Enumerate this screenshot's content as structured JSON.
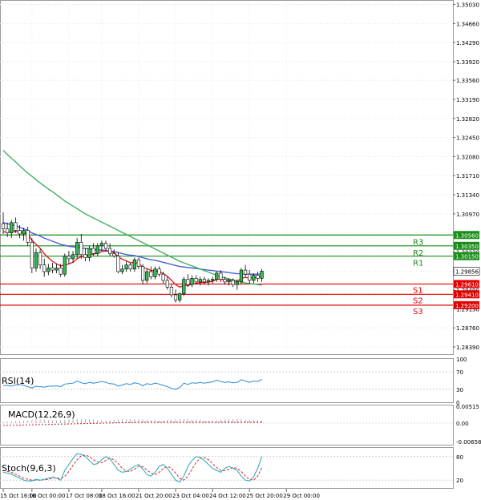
{
  "chart_data": {
    "type": "candlestick",
    "price_axis": {
      "ticks": [
        "1.35030",
        "1.34660",
        "1.34290",
        "1.33920",
        "1.33560",
        "1.33190",
        "1.32820",
        "1.32450",
        "1.32080",
        "1.31710",
        "1.31340",
        "1.30970",
        "1.30600",
        "1.30230",
        "1.29860",
        "1.29490",
        "1.29130",
        "1.28760",
        "1.28390"
      ],
      "ylim": [
        1.2825,
        1.351
      ]
    },
    "time_axis": {
      "labels": [
        "15 Oct 16:00",
        "16 Oct 00:00",
        "17 Oct 08:00",
        "18 Oct 16:00",
        "21 Oct 20:00",
        "23 Oct 04:00",
        "24 Oct 12:00",
        "25 Oct 20:00",
        "29 Oct 00:00"
      ],
      "label_bars": [
        0,
        7,
        16,
        24,
        33,
        42,
        51,
        60,
        69
      ]
    },
    "candles": [
      {
        "o": 1.3078,
        "h": 1.31,
        "l": 1.3058,
        "c": 1.3068
      },
      {
        "o": 1.3068,
        "h": 1.308,
        "l": 1.3052,
        "c": 1.306
      },
      {
        "o": 1.306,
        "h": 1.3085,
        "l": 1.305,
        "c": 1.308
      },
      {
        "o": 1.308,
        "h": 1.309,
        "l": 1.306,
        "c": 1.3065
      },
      {
        "o": 1.3065,
        "h": 1.3075,
        "l": 1.305,
        "c": 1.3058
      },
      {
        "o": 1.3058,
        "h": 1.307,
        "l": 1.3045,
        "c": 1.3065
      },
      {
        "o": 1.3065,
        "h": 1.3072,
        "l": 1.3035,
        "c": 1.3042
      },
      {
        "o": 1.3042,
        "h": 1.305,
        "l": 1.2982,
        "c": 1.2992
      },
      {
        "o": 1.2992,
        "h": 1.303,
        "l": 1.2985,
        "c": 1.3022
      },
      {
        "o": 1.3022,
        "h": 1.3028,
        "l": 1.299,
        "c": 1.2998
      },
      {
        "o": 1.2998,
        "h": 1.301,
        "l": 1.2975,
        "c": 1.2985
      },
      {
        "o": 1.2985,
        "h": 1.3,
        "l": 1.2978,
        "c": 1.2992
      },
      {
        "o": 1.2992,
        "h": 1.3002,
        "l": 1.2982,
        "c": 1.2988
      },
      {
        "o": 1.2988,
        "h": 1.3,
        "l": 1.2982,
        "c": 1.2992
      },
      {
        "o": 1.2992,
        "h": 1.3,
        "l": 1.2975,
        "c": 1.298
      },
      {
        "o": 1.298,
        "h": 1.302,
        "l": 1.2975,
        "c": 1.3015
      },
      {
        "o": 1.3015,
        "h": 1.3025,
        "l": 1.3,
        "c": 1.301
      },
      {
        "o": 1.301,
        "h": 1.3025,
        "l": 1.3002,
        "c": 1.3018
      },
      {
        "o": 1.3018,
        "h": 1.305,
        "l": 1.301,
        "c": 1.3042
      },
      {
        "o": 1.3042,
        "h": 1.3058,
        "l": 1.301,
        "c": 1.3018
      },
      {
        "o": 1.3018,
        "h": 1.303,
        "l": 1.3005,
        "c": 1.3012
      },
      {
        "o": 1.3012,
        "h": 1.3035,
        "l": 1.3005,
        "c": 1.303
      },
      {
        "o": 1.303,
        "h": 1.304,
        "l": 1.3015,
        "c": 1.302
      },
      {
        "o": 1.302,
        "h": 1.304,
        "l": 1.3015,
        "c": 1.3035
      },
      {
        "o": 1.3035,
        "h": 1.3045,
        "l": 1.3025,
        "c": 1.304
      },
      {
        "o": 1.304,
        "h": 1.3045,
        "l": 1.3025,
        "c": 1.303
      },
      {
        "o": 1.303,
        "h": 1.304,
        "l": 1.3015,
        "c": 1.302
      },
      {
        "o": 1.302,
        "h": 1.3028,
        "l": 1.3012,
        "c": 1.3015
      },
      {
        "o": 1.3015,
        "h": 1.3022,
        "l": 1.2982,
        "c": 1.2985
      },
      {
        "o": 1.2985,
        "h": 1.2998,
        "l": 1.298,
        "c": 1.299
      },
      {
        "o": 1.299,
        "h": 1.3005,
        "l": 1.2985,
        "c": 1.2998
      },
      {
        "o": 1.2998,
        "h": 1.3002,
        "l": 1.2985,
        "c": 1.299
      },
      {
        "o": 1.299,
        "h": 1.3012,
        "l": 1.2985,
        "c": 1.3008
      },
      {
        "o": 1.3008,
        "h": 1.3012,
        "l": 1.299,
        "c": 1.2995
      },
      {
        "o": 1.2995,
        "h": 1.3,
        "l": 1.296,
        "c": 1.2968
      },
      {
        "o": 1.2968,
        "h": 1.299,
        "l": 1.2962,
        "c": 1.2985
      },
      {
        "o": 1.2985,
        "h": 1.2995,
        "l": 1.297,
        "c": 1.2975
      },
      {
        "o": 1.2975,
        "h": 1.2995,
        "l": 1.297,
        "c": 1.299
      },
      {
        "o": 1.299,
        "h": 1.2995,
        "l": 1.2975,
        "c": 1.298
      },
      {
        "o": 1.298,
        "h": 1.2985,
        "l": 1.2962,
        "c": 1.2968
      },
      {
        "o": 1.2968,
        "h": 1.2975,
        "l": 1.295,
        "c": 1.2955
      },
      {
        "o": 1.2955,
        "h": 1.296,
        "l": 1.2935,
        "c": 1.294
      },
      {
        "o": 1.294,
        "h": 1.295,
        "l": 1.2925,
        "c": 1.293
      },
      {
        "o": 1.293,
        "h": 1.2945,
        "l": 1.2925,
        "c": 1.2942
      },
      {
        "o": 1.2942,
        "h": 1.2975,
        "l": 1.2938,
        "c": 1.297
      },
      {
        "o": 1.297,
        "h": 1.298,
        "l": 1.2955,
        "c": 1.296
      },
      {
        "o": 1.296,
        "h": 1.2978,
        "l": 1.2955,
        "c": 1.2972
      },
      {
        "o": 1.2972,
        "h": 1.2978,
        "l": 1.296,
        "c": 1.2965
      },
      {
        "o": 1.2965,
        "h": 1.2975,
        "l": 1.2958,
        "c": 1.297
      },
      {
        "o": 1.297,
        "h": 1.2975,
        "l": 1.296,
        "c": 1.2965
      },
      {
        "o": 1.2965,
        "h": 1.2972,
        "l": 1.2958,
        "c": 1.2968
      },
      {
        "o": 1.2968,
        "h": 1.2975,
        "l": 1.2962,
        "c": 1.297
      },
      {
        "o": 1.297,
        "h": 1.2985,
        "l": 1.2965,
        "c": 1.2982
      },
      {
        "o": 1.2982,
        "h": 1.2988,
        "l": 1.2965,
        "c": 1.297
      },
      {
        "o": 1.297,
        "h": 1.2975,
        "l": 1.296,
        "c": 1.2965
      },
      {
        "o": 1.2965,
        "h": 1.2972,
        "l": 1.2958,
        "c": 1.2968
      },
      {
        "o": 1.2968,
        "h": 1.2972,
        "l": 1.2955,
        "c": 1.296
      },
      {
        "o": 1.296,
        "h": 1.297,
        "l": 1.295,
        "c": 1.2965
      },
      {
        "o": 1.2965,
        "h": 1.2992,
        "l": 1.296,
        "c": 1.2988
      },
      {
        "o": 1.2988,
        "h": 1.2998,
        "l": 1.2975,
        "c": 1.298
      },
      {
        "o": 1.298,
        "h": 1.2988,
        "l": 1.2962,
        "c": 1.2968
      },
      {
        "o": 1.2968,
        "h": 1.2982,
        "l": 1.2962,
        "c": 1.2978
      },
      {
        "o": 1.2978,
        "h": 1.2985,
        "l": 1.2965,
        "c": 1.2972
      },
      {
        "o": 1.2972,
        "h": 1.299,
        "l": 1.2965,
        "c": 1.2986
      }
    ],
    "moving_averages": [
      {
        "color": "#4a5fd6",
        "values": [
          1.308,
          1.3078,
          1.3076,
          1.3074,
          1.3071,
          1.3068,
          1.3065,
          1.306,
          1.3057,
          1.3054,
          1.305,
          1.3047,
          1.3044,
          1.3041,
          1.3038,
          1.3036,
          1.3034,
          1.3033,
          1.3032,
          1.3031,
          1.303,
          1.3029,
          1.3028,
          1.3027,
          1.3027,
          1.3026,
          1.3025,
          1.3024,
          1.3022,
          1.302,
          1.3018,
          1.3017,
          1.3016,
          1.3014,
          1.3012,
          1.301,
          1.3008,
          1.3007,
          1.3005,
          1.3003,
          1.3001,
          1.2999,
          1.2997,
          1.2995,
          1.2994,
          1.2993,
          1.2992,
          1.2991,
          1.299,
          1.2989,
          1.2988,
          1.2987,
          1.2986,
          1.2985,
          1.2984,
          1.2983,
          1.2982,
          1.2981,
          1.2981,
          1.298,
          1.298,
          1.298,
          1.298,
          1.2981
        ]
      },
      {
        "color": "#e02020",
        "values": [
          1.3062,
          1.3062,
          1.3063,
          1.3063,
          1.3062,
          1.3061,
          1.3058,
          1.3046,
          1.3038,
          1.303,
          1.302,
          1.3012,
          1.3005,
          1.3,
          1.2996,
          1.2998,
          1.3,
          1.3003,
          1.301,
          1.3014,
          1.3015,
          1.3018,
          1.3019,
          1.3021,
          1.3024,
          1.3025,
          1.3024,
          1.3022,
          1.3014,
          1.3009,
          1.3006,
          1.3002,
          1.3003,
          1.3001,
          1.2993,
          1.2991,
          1.2987,
          1.2987,
          1.2985,
          1.2981,
          1.2976,
          1.2968,
          1.296,
          1.2955,
          1.2958,
          1.2958,
          1.2961,
          1.2962,
          1.2964,
          1.2964,
          1.2965,
          1.2966,
          1.297,
          1.297,
          1.2969,
          1.2969,
          1.2967,
          1.2966,
          1.2972,
          1.2974,
          1.2972,
          1.2974,
          1.2973,
          1.2977
        ]
      },
      {
        "color": "#40b060",
        "values": [
          1.322,
          1.3212,
          1.3205,
          1.3198,
          1.319,
          1.3183,
          1.3176,
          1.317,
          1.3163,
          1.3157,
          1.3151,
          1.3145,
          1.314,
          1.3134,
          1.3128,
          1.3122,
          1.3117,
          1.3112,
          1.3107,
          1.3102,
          1.3097,
          1.3093,
          1.3089,
          1.3085,
          1.3081,
          1.3077,
          1.3073,
          1.3069,
          1.3065,
          1.3061,
          1.3057,
          1.3053,
          1.3049,
          1.3045,
          1.3041,
          1.3037,
          1.3033,
          1.3029,
          1.3025,
          1.3021,
          1.3017,
          1.3013,
          1.3009,
          1.3005,
          1.3002,
          1.2999,
          1.2996,
          1.2993,
          1.299,
          1.2987,
          1.2984,
          1.2981,
          1.2978,
          1.2975,
          1.2973,
          1.2971,
          1.2969,
          1.2967,
          1.2965,
          1.2963,
          1.2962,
          1.2961,
          1.296,
          1.2959
        ]
      }
    ],
    "levels": [
      {
        "name": "R3",
        "price": 1.3056,
        "label": "1.30560",
        "color": "#1a8c1a"
      },
      {
        "name": "R2",
        "price": 1.3035,
        "label": "1.30350",
        "color": "#1a8c1a"
      },
      {
        "name": "R1",
        "price": 1.3015,
        "label": "1.30150",
        "color": "#1a8c1a"
      },
      {
        "name": "S1",
        "price": 1.2961,
        "label": "1.29610",
        "color": "#e00000"
      },
      {
        "name": "S2",
        "price": 1.2941,
        "label": "1.29410",
        "color": "#e00000"
      },
      {
        "name": "S3",
        "price": 1.292,
        "label": "1.29200",
        "color": "#e00000"
      }
    ],
    "current_price": {
      "label": "1.29856",
      "price": 1.29856
    },
    "rsi": {
      "title": "RSI(14)",
      "ticks": [
        "100",
        "70",
        "30",
        "0"
      ],
      "values": [
        38,
        39,
        37,
        40,
        41,
        39,
        36,
        33,
        37,
        36,
        35,
        37,
        37,
        38,
        36,
        42,
        43,
        44,
        49,
        45,
        43,
        46,
        44,
        46,
        48,
        46,
        43,
        42,
        37,
        40,
        43,
        41,
        45,
        43,
        38,
        43,
        41,
        44,
        42,
        39,
        36,
        32,
        30,
        34,
        44,
        41,
        45,
        44,
        46,
        44,
        46,
        47,
        51,
        48,
        46,
        47,
        45,
        46,
        52,
        49,
        46,
        49,
        48,
        53
      ]
    },
    "macd": {
      "title": "MACD(12,26,9)",
      "ticks": [
        "0.00515",
        "0.00",
        "-0.006584"
      ]
    },
    "stoch": {
      "title": "Stoch(9,6,3)",
      "ticks": [
        "80",
        "20"
      ],
      "k": [
        40,
        38,
        35,
        30,
        25,
        20,
        18,
        18,
        22,
        20,
        22,
        25,
        28,
        25,
        20,
        45,
        60,
        75,
        88,
        86,
        80,
        70,
        60,
        62,
        72,
        80,
        75,
        60,
        45,
        40,
        42,
        48,
        55,
        60,
        48,
        35,
        30,
        40,
        55,
        60,
        50,
        35,
        20,
        15,
        30,
        55,
        70,
        80,
        78,
        70,
        60,
        50,
        45,
        40,
        50,
        55,
        50,
        45,
        30,
        20,
        18,
        28,
        50,
        80
      ],
      "d": [
        45,
        42,
        40,
        35,
        30,
        25,
        22,
        20,
        20,
        20,
        21,
        22,
        25,
        26,
        24,
        30,
        42,
        58,
        72,
        82,
        84,
        80,
        72,
        66,
        64,
        70,
        76,
        72,
        62,
        50,
        43,
        42,
        48,
        55,
        54,
        46,
        38,
        34,
        40,
        50,
        55,
        50,
        38,
        25,
        20,
        30,
        48,
        65,
        76,
        78,
        72,
        62,
        52,
        45,
        44,
        48,
        52,
        50,
        42,
        30,
        22,
        20,
        30,
        52
      ]
    }
  }
}
